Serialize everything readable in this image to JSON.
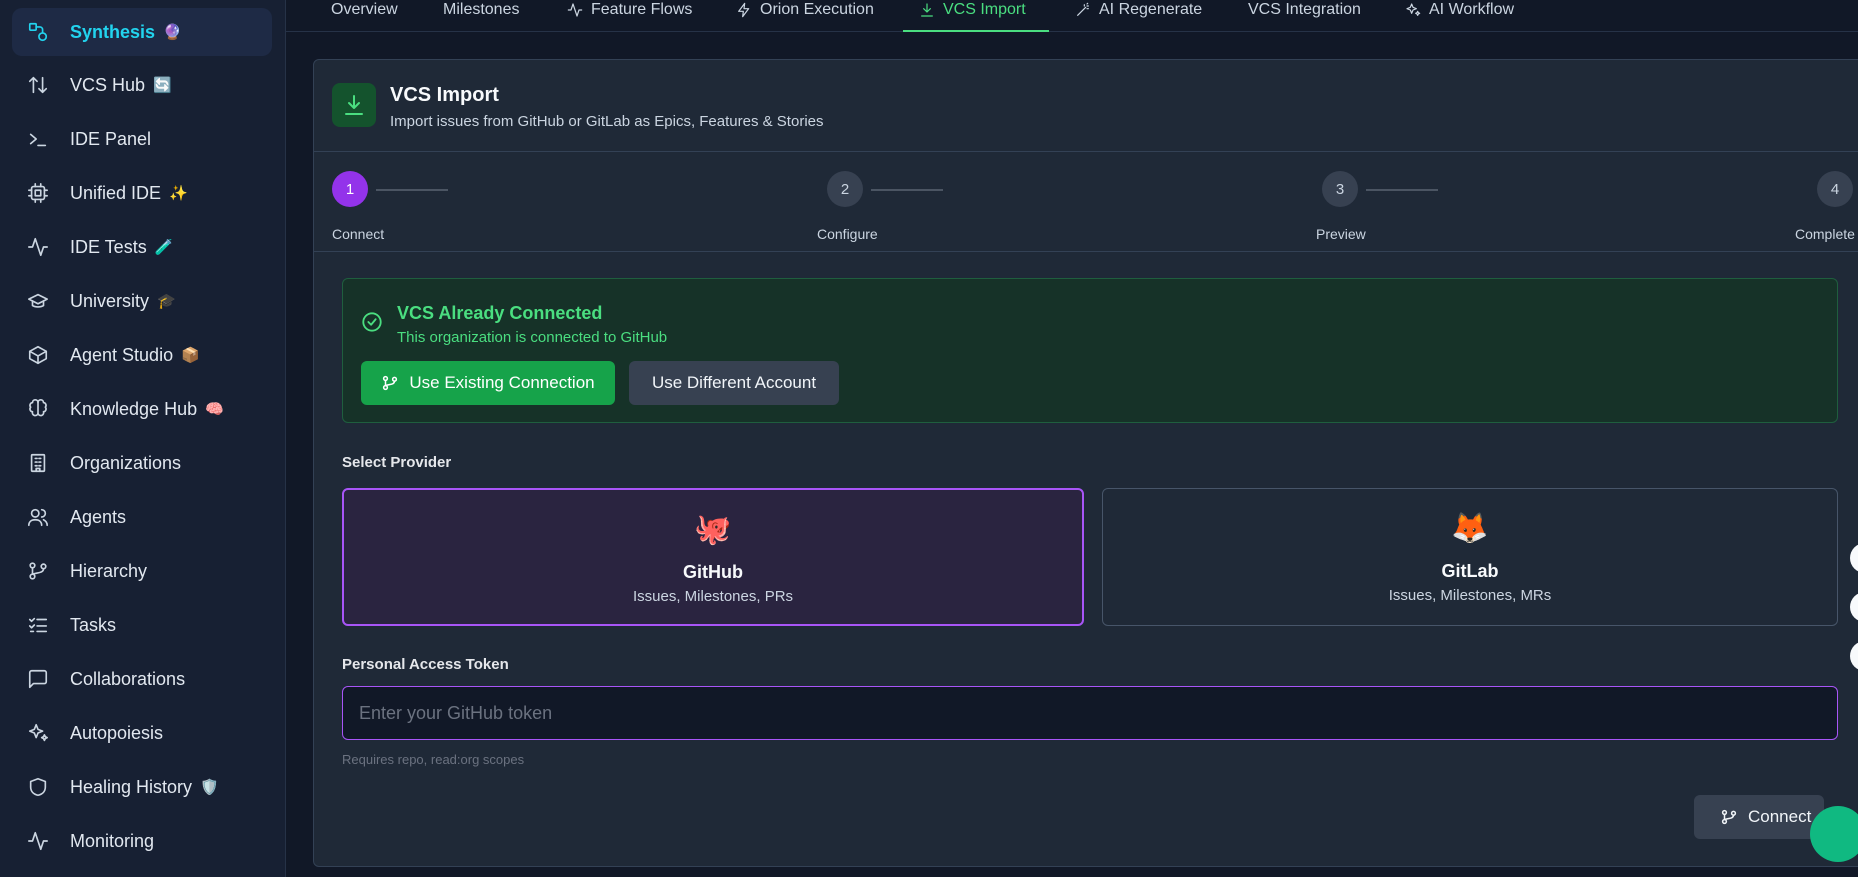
{
  "sidebar": {
    "items": [
      {
        "label": "Synthesis",
        "emoji": "🔮",
        "icon": "synthesis-icon"
      },
      {
        "label": "VCS Hub",
        "emoji": "🔄",
        "icon": "arrows-up-down-icon"
      },
      {
        "label": "IDE Panel",
        "emoji": "",
        "icon": "terminal-icon"
      },
      {
        "label": "Unified IDE",
        "emoji": "✨",
        "icon": "cpu-icon"
      },
      {
        "label": "IDE Tests",
        "emoji": "🧪",
        "icon": "activity-icon"
      },
      {
        "label": "University",
        "emoji": "🎓",
        "icon": "graduation-cap-icon"
      },
      {
        "label": "Agent Studio",
        "emoji": "📦",
        "icon": "box-icon"
      },
      {
        "label": "Knowledge Hub",
        "emoji": "🧠",
        "icon": "brain-icon"
      },
      {
        "label": "Organizations",
        "emoji": "",
        "icon": "building-icon"
      },
      {
        "label": "Agents",
        "emoji": "",
        "icon": "users-icon"
      },
      {
        "label": "Hierarchy",
        "emoji": "",
        "icon": "git-branch-icon"
      },
      {
        "label": "Tasks",
        "emoji": "",
        "icon": "list-checks-icon"
      },
      {
        "label": "Collaborations",
        "emoji": "",
        "icon": "message-square-icon"
      },
      {
        "label": "Autopoiesis",
        "emoji": "",
        "icon": "sparkles-icon"
      },
      {
        "label": "Healing History",
        "emoji": "🛡️",
        "icon": "shield-icon"
      },
      {
        "label": "Monitoring",
        "emoji": "",
        "icon": "activity-icon"
      }
    ]
  },
  "tabs": [
    {
      "label": "Overview"
    },
    {
      "label": "Milestones"
    },
    {
      "label": "Feature Flows"
    },
    {
      "label": "Orion Execution"
    },
    {
      "label": "VCS Import"
    },
    {
      "label": "AI Regenerate"
    },
    {
      "label": "VCS Integration"
    },
    {
      "label": "AI Workflow"
    }
  ],
  "card": {
    "title": "VCS Import",
    "subtitle": "Import issues from GitHub or GitLab as Epics, Features & Stories"
  },
  "steps": [
    {
      "number": "1",
      "label": "Connect"
    },
    {
      "number": "2",
      "label": "Configure"
    },
    {
      "number": "3",
      "label": "Preview"
    },
    {
      "number": "4",
      "label": "Complete"
    }
  ],
  "connected": {
    "title": "VCS Already Connected",
    "subtitle": "This organization is connected to GitHub",
    "use_existing": "Use Existing Connection",
    "use_different": "Use Different Account"
  },
  "provider": {
    "section_label": "Select Provider",
    "options": [
      {
        "emoji": "🐙",
        "name": "GitHub",
        "desc": "Issues, Milestones, PRs"
      },
      {
        "emoji": "🦊",
        "name": "GitLab",
        "desc": "Issues, Milestones, MRs"
      }
    ]
  },
  "token": {
    "label": "Personal Access Token",
    "placeholder": "Enter your GitHub token",
    "hint": "Requires repo, read:org scopes"
  },
  "connect_button": "Connect",
  "colors": {
    "accent_cyan": "#22d3ee",
    "accent_green": "#4ade80",
    "accent_purple": "#a855f7"
  }
}
